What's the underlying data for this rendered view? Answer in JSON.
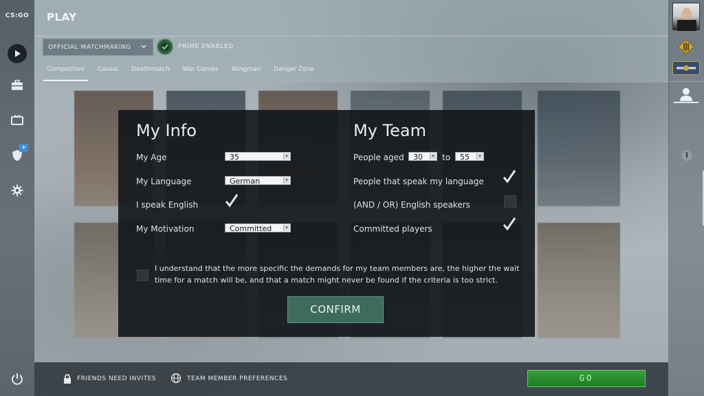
{
  "app": {
    "logo_text": "CS:GO",
    "title": "PLAY"
  },
  "left_rail": {
    "items": [
      {
        "name": "play",
        "icon": "play-icon"
      },
      {
        "name": "inventory",
        "icon": "briefcase-icon"
      },
      {
        "name": "watch",
        "icon": "tv-icon"
      },
      {
        "name": "operation",
        "icon": "shield-icon",
        "badge": "+"
      },
      {
        "name": "settings",
        "icon": "gear-icon"
      }
    ],
    "power_icon": "power-icon"
  },
  "header": {
    "mode_select": "OFFICIAL MATCHMAKING",
    "prime_label": "PRIME ENABLED",
    "tabs": [
      {
        "label": "Competitive",
        "active": true
      },
      {
        "label": "Casual",
        "active": false
      },
      {
        "label": "Deathmatch",
        "active": false
      },
      {
        "label": "War Games",
        "active": false
      },
      {
        "label": "Wingman",
        "active": false
      },
      {
        "label": "Danger Zone",
        "active": false
      }
    ]
  },
  "dialog": {
    "my_info": {
      "title": "My Info",
      "age_label": "My Age",
      "age_value": "35",
      "language_label": "My Language",
      "language_value": "German",
      "english_label": "I speak English",
      "english_checked": true,
      "motivation_label": "My Motivation",
      "motivation_value": "Committed"
    },
    "my_team": {
      "title": "My Team",
      "aged_label": "People aged",
      "aged_from": "30",
      "aged_to_label": "to",
      "aged_to": "55",
      "speak_language_label": "People that speak my language",
      "speak_language_checked": true,
      "english_speakers_label": "(AND / OR) English speakers",
      "english_speakers_checked": false,
      "committed_label": "Committed players",
      "committed_checked": true
    },
    "disclaimer": "I understand that the more specific the demands for my team members are, the higher the wait time for a match will be, and that a match might never be found if the criteria is too strict.",
    "disclaimer_checked": false,
    "confirm_label": "CONFIRM"
  },
  "footer": {
    "friends_invites": "FRIENDS NEED INVITES",
    "team_prefs": "TEAM MEMBER PREFERENCES",
    "go_label": "GO"
  },
  "colors": {
    "go_green": "#1f7a24",
    "confirm_green": "#3f6b5a",
    "dialog_bg": "#12161a"
  }
}
